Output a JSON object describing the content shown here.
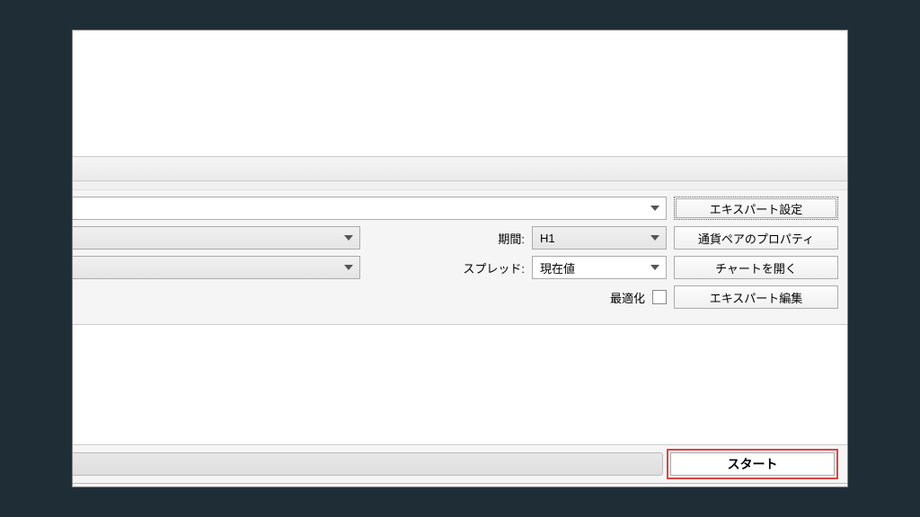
{
  "labels": {
    "period": "期間:",
    "spread": "スプレッド:",
    "optimize": "最適化"
  },
  "dropdowns": {
    "expert": "",
    "symbol": "",
    "model": "",
    "period_value": "H1",
    "spread_value": "現在値"
  },
  "buttons": {
    "expert_settings": "エキスパート設定",
    "symbol_properties": "通貨ペアのプロパティ",
    "open_chart": "チャートを開く",
    "expert_edit": "エキスパート編集",
    "start": "スタート"
  }
}
